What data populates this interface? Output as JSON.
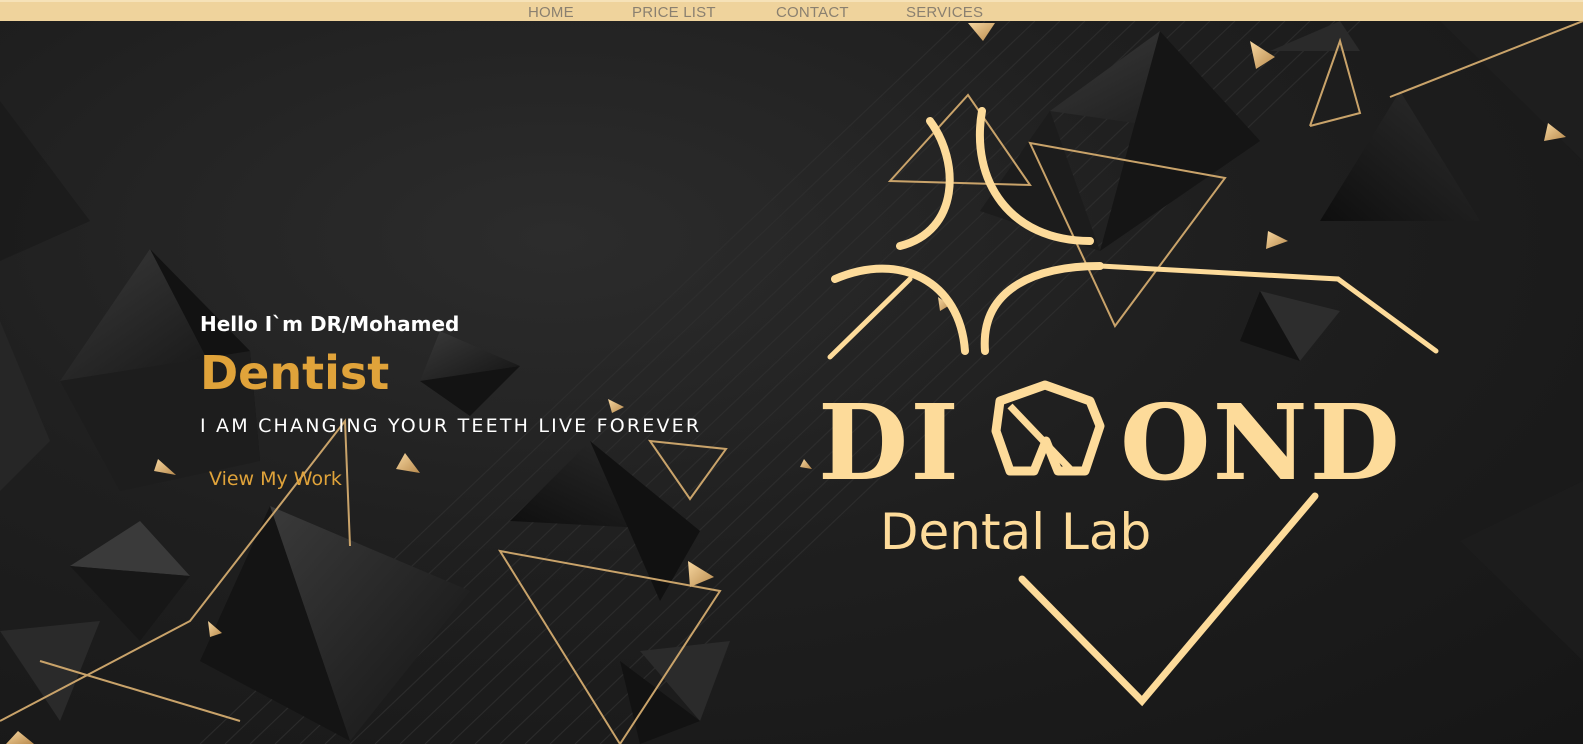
{
  "nav": {
    "items": [
      {
        "label": "HOME"
      },
      {
        "label": "PRICE LIST"
      },
      {
        "label": "CONTACT"
      },
      {
        "label": "SERVICES"
      }
    ]
  },
  "hero": {
    "greeting": "Hello I`m DR/Mohamed",
    "role": "Dentist",
    "tagline": "I AM CHANGING YOUR TEETH LIVE FOREVER",
    "cta_label": "View My Work"
  },
  "logo": {
    "brand_word": "DIAMOND",
    "subtitle": "Dental Lab"
  },
  "colors": {
    "nav_background": "#efd39c",
    "nav_text": "#8a8070",
    "accent_gold": "#e0a33a",
    "logo_cream": "#fddb9a",
    "background_dark": "#1b1b1b"
  }
}
